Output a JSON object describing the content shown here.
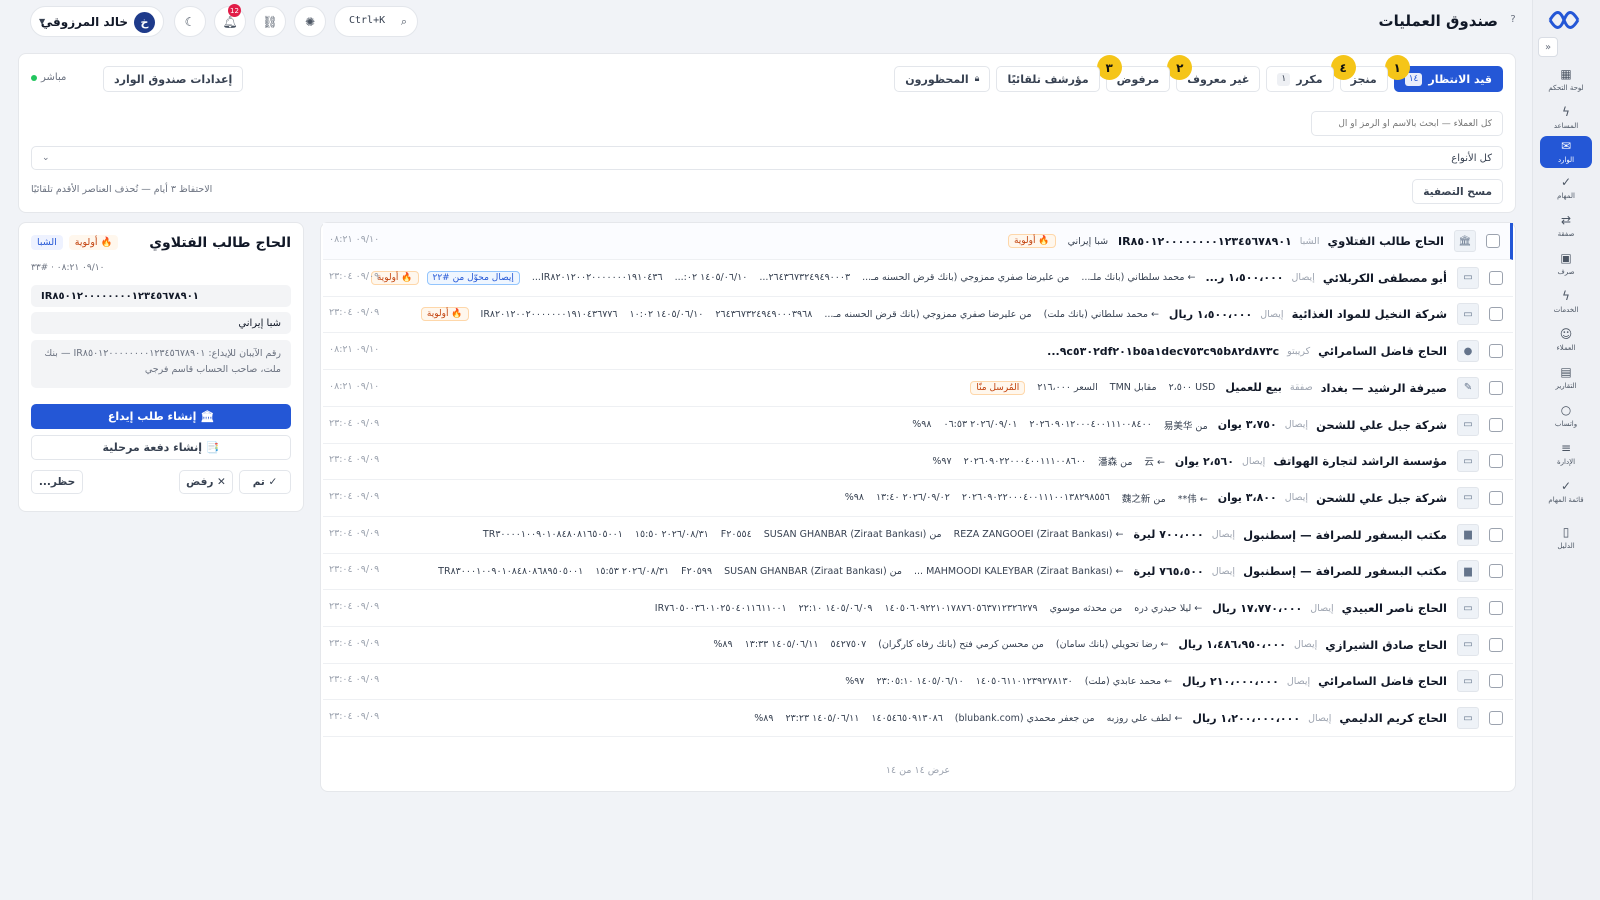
{
  "header": {
    "title": "صندوق العمليات",
    "user": {
      "initial": "خ",
      "name": "خالد المرزوقي"
    },
    "notif_count": "12",
    "search_shortcut": "Ctrl+K"
  },
  "sidebar": {
    "items": [
      {
        "label": "لوحة التحكم",
        "icon": "dashboard-icon",
        "glyph": "▦"
      },
      {
        "label": "المساعد",
        "icon": "bolt-icon",
        "glyph": "ϟ"
      },
      {
        "label": "الوارد",
        "icon": "inbox-icon",
        "glyph": "✉"
      },
      {
        "label": "المهام",
        "icon": "check-icon",
        "glyph": "✓"
      },
      {
        "label": "صفقة",
        "icon": "swap-icon",
        "glyph": "⇄"
      },
      {
        "label": "صرف",
        "icon": "cash-icon",
        "glyph": "▣"
      },
      {
        "label": "الخدمات",
        "icon": "services-icon",
        "glyph": "ϟ"
      },
      {
        "label": "العملاء",
        "icon": "users-icon",
        "glyph": "☺"
      },
      {
        "label": "التقارير",
        "icon": "report-icon",
        "glyph": "▤"
      },
      {
        "label": "واتساب",
        "icon": "chat-icon",
        "glyph": "○"
      },
      {
        "label": "الإدارة",
        "icon": "sliders-icon",
        "glyph": "≡"
      },
      {
        "label": "قائمة المهام",
        "icon": "tasklist-icon",
        "glyph": "✓"
      },
      {
        "label": "الدليل",
        "icon": "book-icon",
        "glyph": "▯"
      }
    ]
  },
  "toolbar": {
    "tabs": [
      {
        "label": "قيد الانتظار",
        "count": "١٤",
        "badge": "١",
        "active": true
      },
      {
        "label": "منجز",
        "count": "",
        "badge": "٤"
      },
      {
        "label": "مكرر",
        "count": "١",
        "badge": ""
      },
      {
        "label": "غير معروف",
        "count": "",
        "badge": "٢"
      },
      {
        "label": "مرفوض",
        "count": "",
        "badge": "٣"
      },
      {
        "label": "مؤرشف تلقائيًا",
        "count": "",
        "badge": ""
      },
      {
        "label": "المحظورون",
        "count": "",
        "badge": ""
      }
    ],
    "settings_label": "إعدادات صندوق الوارد",
    "live_label": "مباشر"
  },
  "filters": {
    "search_placeholder": "كل العملاء — ابحث بالاسم أو الرمز أو ال",
    "type_label": "كل الأنواع",
    "clear_label": "مسح التصفية",
    "retention_text": "الاحتفاظ ٣ أيام — تُحذف العناصر الأقدم تلقائيًا"
  },
  "rows": [
    {
      "customer": "الحاج طالب الفتلاوي",
      "tag": "الشبا",
      "amount": "IR٨٥٠١٢٠٠٠٠٠٠٠٠١٢٣٤٥٦٧٨٩٠١",
      "meta": [
        "شبا إيراني"
      ],
      "pill": "🔥 أولوية",
      "pill2": "",
      "time": "٠٩/١٠ ٠٨:٢١",
      "selected": true,
      "thumb": "🏛"
    },
    {
      "customer": "أبو مصطفى الكربلائي",
      "tag": "إيصال",
      "amount": "١،٥٠٠،٠٠٠ ر...",
      "meta": [
        "← محمد سلطاني (بانك ملـ...",
        "من عليرضا صفري ممزوجي (بانك قرض الحسنه مـ...",
        "٢٦٤٣٦٧٣٢٤٩٤٩٠٠٠٣...",
        "١٤٠٥/٠٦/١٠ ٠٢:...",
        "IR٨٢٠١٢٠٠٢٠٠٠٠٠٠٠١٩١٠٤٣٦..."
      ],
      "pill": "🔥 أولوية",
      "pill2": "إيصال محوّل من #٢٢",
      "time": "٠٩/٠٩ ٢٣:٠٤",
      "thumb": "▭"
    },
    {
      "customer": "شركة النخيل للمواد الغذائية",
      "tag": "إيصال",
      "amount": "١،٥٠٠،٠٠٠ ريال",
      "meta": [
        "← محمد سلطاني (بانك ملت)",
        "من عليرضا صفري ممزوجي (بانك قرض الحسنه مـ...",
        "٢٦٤٣٦٧٣٢٤٩٤٩٠٠٠٣٩٦٨",
        "١٤٠٥/٠٦/١٠ ١٠:٠٢",
        "IR٨٢٠١٢٠٠٢٠٠٠٠٠٠٠١٩١٠٤٣٦٧٧٦"
      ],
      "pill": "🔥 أولوية",
      "pill2": "",
      "time": "٠٩/٠٩ ٢٣:٠٤",
      "thumb": "▭"
    },
    {
      "customer": "الحاج فاضل السامرائي",
      "tag": "كريبتو",
      "amount": "٩c٥٣٠٢df٢٠١b٥a١dec٧٥٣c٩٥b٨٢d٨٧٣c...",
      "meta": [],
      "pill": "",
      "pill2": "",
      "time": "٠٩/١٠ ٠٨:٢١",
      "thumb": "●"
    },
    {
      "customer": "صيرفة الرشيد — بغداد",
      "tag": "صفقة",
      "amount": "بيع للعميل",
      "meta": [
        "USD ٢،٥٠٠",
        "مقابل TMN",
        "السعر ٢١٦،٠٠٠"
      ],
      "pill": "",
      "pill2": "",
      "tagpill": "المُرسل منّا",
      "time": "٠٩/١٠ ٠٨:٢١",
      "thumb": "✎"
    },
    {
      "customer": "شركة جبل علي للشحن",
      "tag": "إيصال",
      "amount": "٣،٧٥٠ يوان",
      "meta": [
        "من 易美华",
        "٢٠٢٦٠٩٠١٢٠٠٠٤٠٠١١١٠٠٨٤٠٠",
        "٢٠٢٦/٠٩/٠١ ٠٦:٥٣",
        "٩٨%"
      ],
      "pill": "",
      "pill2": "",
      "time": "٠٩/٠٩ ٢٣:٠٤",
      "thumb": "▭"
    },
    {
      "customer": "مؤسسة الراشد لتجارة الهواتف",
      "tag": "إيصال",
      "amount": "٢،٥٦٠ يوان",
      "meta": [
        "← 云",
        "من 潘森",
        "٢٠٢٦٠٩٠٢٢٠٠٠٤٠٠١١١٠٠٨٦٠٠",
        "٩٧%"
      ],
      "pill": "",
      "pill2": "",
      "time": "٠٩/٠٩ ٢٣:٠٤",
      "thumb": "▭"
    },
    {
      "customer": "شركة جبل علي للشحن",
      "tag": "إيصال",
      "amount": "٣،٨٠٠ يوان",
      "meta": [
        "← 伟**",
        "من 魏之新",
        "٢٠٢٦٠٩٠٢٢٠٠٠٤٠٠١١١٠٠١٣٨٢٩٨٥٥٦",
        "٢٠٢٦/٠٩/٠٢ ١٣:٤٠",
        "٩٨%"
      ],
      "pill": "",
      "pill2": "",
      "time": "٠٩/٠٩ ٢٣:٠٤",
      "thumb": "▭"
    },
    {
      "customer": "مكتب البسفور للصرافة — إسطنبول",
      "tag": "إيصال",
      "amount": "٧٠٠،٠٠٠ ليرة",
      "meta": [
        "← REZA ZANGOOEI (Ziraat Bankası)",
        "من SUSAN GHANBAR (Ziraat Bankası)",
        "F٢٠٥٥٤",
        "٢٠٢٦/٠٨/٣١ ١٥:٥٠",
        "TR٣٠٠٠٠١٠٠٩٠١٠٨٤٨٠٨١٦٥٠٥٠٠١"
      ],
      "pill": "",
      "pill2": "",
      "time": "٠٩/٠٩ ٢٣:٠٤",
      "thumb": "▆"
    },
    {
      "customer": "مكتب البسفور للصرافة — إسطنبول",
      "tag": "إيصال",
      "amount": "٧٦٥،٥٠٠ ليرة",
      "meta": [
        "← MAHMOODI KALEYBAR (Ziraat Bankası) ...",
        "من SUSAN GHANBAR (Ziraat Bankası)",
        "F٢٠٥٩٩",
        "٢٠٢٦/٠٨/٣١ ١٥:٥٣",
        "TR٨٣٠٠٠١٠٠٩٠١٠٨٤٨٠٨٦٨٩٥٠٥٠٠١"
      ],
      "pill": "",
      "pill2": "",
      "time": "٠٩/٠٩ ٢٣:٠٤",
      "thumb": "▆"
    },
    {
      "customer": "الحاج ناصر العبيدي",
      "tag": "إيصال",
      "amount": "١٧،٧٧٠،٠٠٠ ريال",
      "meta": [
        "← ليلا حيدري دره",
        "من محدثه موسوي",
        "١٤٠٥٠٦٠٩٢٢١٠١٧٨٧٦٠٥٦٣٧١٢٣٢٦٢٧٩",
        "١٤٠٥/٠٦/٠٩ ٢٢:١٠",
        "IR٧٦٠٥٠٠٣٦٠١٠٢٥٠٤٠١١٦١١٠٠١"
      ],
      "pill": "",
      "pill2": "",
      "time": "٠٩/٠٩ ٢٣:٠٤",
      "thumb": "▭"
    },
    {
      "customer": "الحاج صادق الشيرازي",
      "tag": "إيصال",
      "amount": "١،٤٨٦،٩٥٠،٠٠٠ ريال",
      "meta": [
        "← رضا تحويلي (بانك سامان)",
        "من محسن كرمي فتح (بانك رفاه كارگران)",
        "٥٤٢٧٥٠٧",
        "١٤٠٥/٠٦/١١ ١٣:٣٣",
        "٨٩%"
      ],
      "pill": "",
      "pill2": "",
      "time": "٠٩/٠٩ ٢٣:٠٤",
      "thumb": "▭"
    },
    {
      "customer": "الحاج فاضل السامرائي",
      "tag": "إيصال",
      "amount": "٢١٠،٠٠٠،٠٠٠ ريال",
      "meta": [
        "← محمد عابدي (ملت)",
        "١٤٠٥٠٦١١٠١٢٣٩٢٧٨١٣٠",
        "١٤٠٥/٠٦/١٠ ٢٣:٠٥:١٠",
        "٩٧%"
      ],
      "pill": "",
      "pill2": "",
      "time": "٠٩/٠٩ ٢٣:٠٤",
      "thumb": "▭"
    },
    {
      "customer": "الحاج كريم الدليمي",
      "tag": "إيصال",
      "amount": "١،٢٠٠،٠٠٠،٠٠٠ ريال",
      "meta": [
        "← لطف علي روزبه",
        "من جعفر محمدي (blubank.com)",
        "١٤٠٥٤٦٥٠٩١٣٠٨٦",
        "١٤٠٥/٠٦/١١ ٢٣:٢٣",
        "٨٩%"
      ],
      "pill": "",
      "pill2": "",
      "time": "٠٩/٠٩ ٢٣:٠٤",
      "thumb": "▭"
    }
  ],
  "list_footer": "عرض ١٤ من ١٤",
  "detail": {
    "title": "الحاج طالب الفتلاوي",
    "tag_sheba": "الشبا",
    "tag_priority": "🔥 أولوية",
    "subtitle": "٠٩/١٠ ٠٨:٢١ · #٣٣",
    "iban": "IR٨٥٠١٢٠٠٠٠٠٠٠٠١٢٣٤٥٦٧٨٩٠١",
    "type": "شبا إيراني",
    "note": "رقم الآيبان للإيداع: IR٨٥٠١٢٠٠٠٠٠٠٠٠١٢٣٤٥٦٧٨٩٠١ — بنك ملت، صاحب الحساب قاسم فرجي",
    "primary_label": "🏛 إنشاء طلب إيداع",
    "secondary_label": "📑 إنشاء دفعة مرحلية",
    "done_label": "✓ تم",
    "reject_label": "✕ رفض",
    "block_label": "حظر..."
  },
  "colors": {
    "accent": "#2457d6",
    "badge": "#f5c518",
    "priority": "#c2410c"
  }
}
